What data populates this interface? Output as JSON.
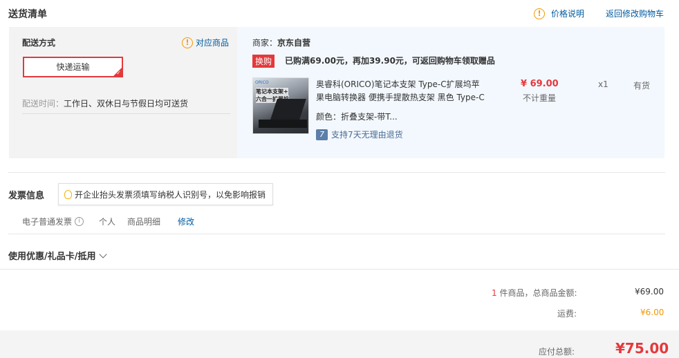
{
  "header": {
    "title": "送货清单",
    "price_note": "价格说明",
    "back_to_cart": "返回修改购物车"
  },
  "delivery": {
    "method_label": "配送方式",
    "match_products": "对应商品",
    "selected_method": "快递运输",
    "time_label": "配送时间：",
    "time_value": "工作日、双休日与节假日均可送货"
  },
  "merchant": {
    "label": "商家：",
    "name": "京东自营",
    "promo_tag": "换购",
    "promo_text": "已购满69.00元，再加39.90元，可返回购物车领取赠品"
  },
  "product": {
    "thumb_text_1": "笔记本支架+",
    "thumb_text_2": "六合一扩展坞",
    "thumb_brand": "ORICO",
    "title_line1": "奥睿科(ORICO)笔记本支架 Type-C扩展坞苹",
    "title_line2": "果电脑转换器 便携手提散热支架 黑色 Type-C",
    "color_label": "颜色：",
    "color_value": "折叠支架-带T...",
    "return_badge": "7",
    "return_text": "支持7天无理由退货",
    "price": "¥ 69.00",
    "weight": "不计重量",
    "qty": "x1",
    "stock": "有货"
  },
  "invoice": {
    "title": "发票信息",
    "tip": "开企业抬头发票须填写纳税人识别号，以免影响报销",
    "type": "电子普通发票",
    "holder": "个人",
    "content": "商品明细",
    "edit": "修改"
  },
  "coupon": {
    "title": "使用优惠/礼品卡/抵用"
  },
  "summary": {
    "count": "1",
    "count_suffix": " 件商品，总商品金额:",
    "goods_amount": "¥69.00",
    "shipping_label": "运费:",
    "shipping_value": "¥6.00",
    "payable_label": "应付总额:",
    "payable_value": "¥75.00"
  },
  "colors": {
    "accent_red": "#e4393c",
    "link_blue": "#005aa0",
    "panel_gray": "#f3f3f3",
    "panel_blue": "#f3f8fe",
    "warn_orange": "#f39800"
  }
}
